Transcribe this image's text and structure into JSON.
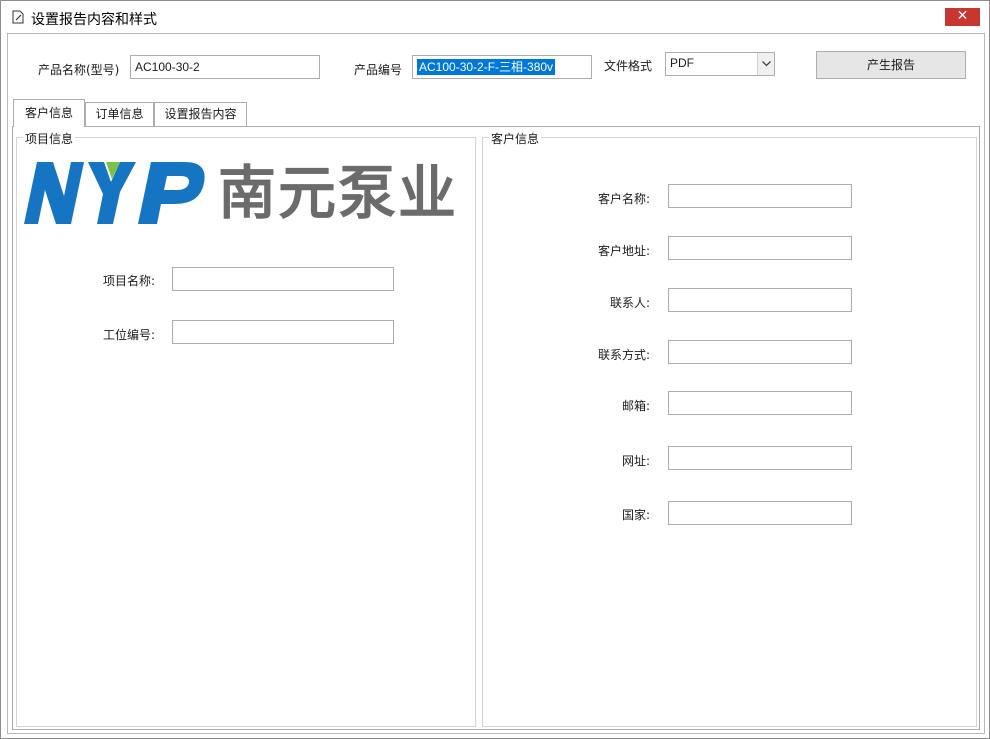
{
  "window": {
    "title": "设置报告内容和样式",
    "close_label": "✕"
  },
  "top": {
    "product_name_label": "产品名称(型号)",
    "product_name_value": "AC100-30-2",
    "product_code_label": "产品编号",
    "product_code_value": "AC100-30-2-F-三相-380v",
    "file_format_label": "文件格式",
    "file_format_value": "PDF",
    "generate_label": "产生报告"
  },
  "tabs": [
    {
      "label": "客户信息",
      "active": true
    },
    {
      "label": "订单信息",
      "active": false
    },
    {
      "label": "设置报告内容",
      "active": false
    }
  ],
  "project_group": {
    "title": "项目信息",
    "logo_text": "NYP",
    "logo_cn": "南元泵业",
    "fields": [
      {
        "label": "项目名称:",
        "value": ""
      },
      {
        "label": "工位编号:",
        "value": ""
      }
    ]
  },
  "customer_group": {
    "title": "客户信息",
    "fields": [
      {
        "label": "客户名称:",
        "value": ""
      },
      {
        "label": "客户地址:",
        "value": ""
      },
      {
        "label": "联系人:",
        "value": ""
      },
      {
        "label": "联系方式:",
        "value": ""
      },
      {
        "label": "邮箱:",
        "value": ""
      },
      {
        "label": "网址:",
        "value": ""
      },
      {
        "label": "国家:",
        "value": ""
      }
    ]
  },
  "colors": {
    "logo_blue": "#1675c2",
    "logo_green": "#7cc242",
    "logo_gray": "#6b6b6b",
    "close_red": "#c7372f",
    "selection": "#0078d7"
  }
}
